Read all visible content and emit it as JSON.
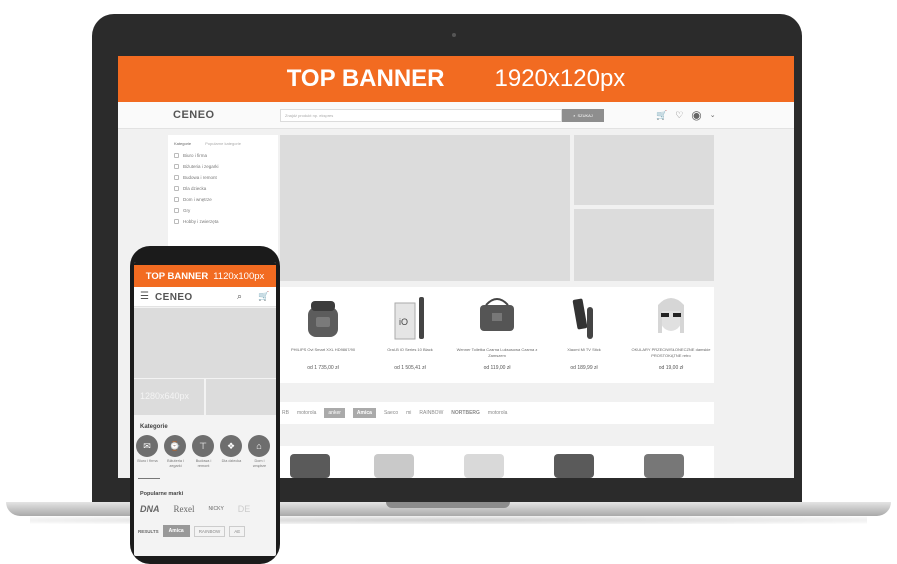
{
  "desktop": {
    "top_banner": {
      "title": "TOP BANNER",
      "size": "1920x120px"
    },
    "header": {
      "logo": "CENEO",
      "search_placeholder": "Znajdź produkt np. ekspres",
      "search_button": "SZUKAJ",
      "icons": [
        "cart-icon",
        "heart-icon",
        "user-icon",
        "chevron-down-icon"
      ]
    },
    "sidebar": {
      "tabs": [
        "Kategorie",
        "Popularne kategorie"
      ],
      "items": [
        "Biuro i firma",
        "Biżuteria i zegarki",
        "Budowa i remont",
        "Dla dziecka",
        "Dom i wnętrze",
        "Gry",
        "Hobby i zwierzęta"
      ]
    },
    "products": [
      {
        "name": "PHILIPS Ovi Smart XXL HD9867/90",
        "price": "od 1 735,00 zł"
      },
      {
        "name": "Oral-B iO Series 10 Black",
        "price": "od 1 505,41 zł"
      },
      {
        "name": "Wenner Toiletka Czarna Luksusowa Czarna z Zamszem",
        "price": "od 119,00 zł"
      },
      {
        "name": "Xiaomi Mi TV Stick",
        "price": "od 189,99 zł"
      },
      {
        "name": "OKULARY PRZECIWSŁONECZNE damskie PROSTOKĄTNE retro",
        "price": "od 19,00 zł"
      }
    ],
    "brands": [
      "RB",
      "motorola",
      "anker",
      "Amica",
      "Saeco",
      "mi",
      "",
      "RAINBOW",
      "NORTBERG",
      "",
      "",
      "motorola"
    ]
  },
  "mobile": {
    "top_banner": {
      "title": "TOP BANNER",
      "size": "1120x100px"
    },
    "header": {
      "logo": "CENEO",
      "icons": [
        "menu-icon",
        "search-icon",
        "cart-icon"
      ]
    },
    "slot_label": "1280x640px",
    "categories_title": "Kategorie",
    "categories": [
      {
        "label": "Biuro i firma",
        "icon": "envelope-icon"
      },
      {
        "label": "Biżuteria i zegarki",
        "icon": "watch-icon"
      },
      {
        "label": "Budowa i remont",
        "icon": "paint-roller-icon"
      },
      {
        "label": "Dla dziecka",
        "icon": "toy-icon"
      },
      {
        "label": "Dom i wnętrze",
        "icon": "home-icon"
      }
    ],
    "popular_title": "Popularne marki",
    "popular_brands_row1": [
      "DNA",
      "Rexel",
      "NICKY",
      "DE"
    ],
    "popular_brands_row2": [
      "RESULTS",
      "Amica",
      "RAINBOW",
      "AE"
    ]
  }
}
